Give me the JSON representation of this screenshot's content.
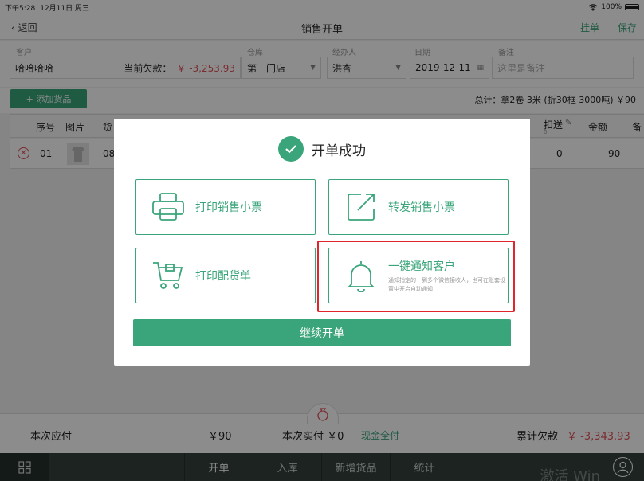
{
  "statusbar": {
    "time": "下午5:28",
    "date": "12月11日 周三",
    "battery": "100%"
  },
  "navbar": {
    "back_label": "返回",
    "title": "销售开单",
    "hang_label": "挂单",
    "save_label": "保存"
  },
  "form": {
    "customer_label": "客户",
    "customer_value": "哈哈哈哈",
    "debt_label": "当前欠款：",
    "debt_value": "￥ -3,253.93",
    "warehouse_label": "仓库",
    "warehouse_value": "第一门店",
    "handler_label": "经办人",
    "handler_value": "洪杏",
    "date_label": "日期",
    "date_value": "2019-12-11",
    "note_label": "备注",
    "note_placeholder": "这里是备注"
  },
  "add_goods_label": "+ 添加货品",
  "total_summary": "总计：拿2卷 3米 (折30框 3000吨) ￥90",
  "table": {
    "headers": {
      "seq": "序号",
      "image": "图片",
      "goods": "货",
      "discount": "扣送",
      "discount_sub": "0",
      "amount": "金额",
      "extra": "备"
    },
    "row": {
      "seq": "01",
      "goods": "08",
      "discount": "0",
      "amount": "90"
    }
  },
  "footer": {
    "payable_label": "本次应付",
    "payable_value": "￥90",
    "paid_label": "本次实付 ￥0",
    "paid_mode": "现金全付",
    "debt_total_label": "累计欠款",
    "debt_total_value": "￥ -3,343.93"
  },
  "tabbar": {
    "tabs": [
      "开单",
      "入库",
      "新增货品",
      "统计"
    ],
    "watermark": "激活 Win"
  },
  "modal": {
    "title": "开单成功",
    "print_receipt": "打印销售小票",
    "forward_receipt": "转发销售小票",
    "print_picklist": "打印配货单",
    "notify_customer": "一键通知客户",
    "notify_desc": "通知指定的一到多个微信接收人，也可在账套设置中开启自动通知",
    "continue_label": "继续开单"
  },
  "colors": {
    "accent": "#3aa57a",
    "danger": "#e0505a",
    "highlight": "#e0262b",
    "tabbar": "#33413d"
  },
  "icons": [
    "chevron-left-icon",
    "wifi-icon",
    "battery-icon",
    "calendar-icon",
    "check-icon",
    "printer-icon",
    "share-icon",
    "cart-icon",
    "bell-icon",
    "money-bag-icon",
    "grid-icon",
    "user-icon",
    "delete-icon",
    "pencil-icon"
  ]
}
